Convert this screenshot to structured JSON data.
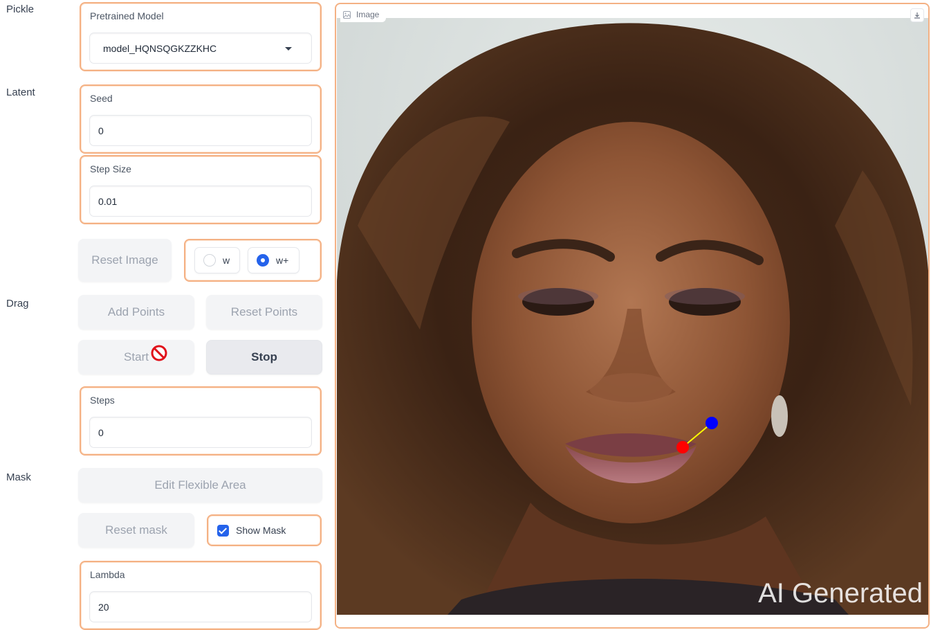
{
  "sections": {
    "pickle": "Pickle",
    "latent": "Latent",
    "drag": "Drag",
    "mask": "Mask"
  },
  "pretrained_model": {
    "label": "Pretrained Model",
    "value": "model_HQNSQGKZZKHC"
  },
  "seed": {
    "label": "Seed",
    "value": "0"
  },
  "step_size": {
    "label": "Step Size",
    "value": "0.01"
  },
  "reset_image_label": "Reset Image",
  "latent_space": {
    "options": [
      "w",
      "w+"
    ],
    "selected": "w+"
  },
  "add_points_label": "Add Points",
  "reset_points_label": "Reset Points",
  "start_label": "Start",
  "stop_label": "Stop",
  "steps": {
    "label": "Steps",
    "value": "0"
  },
  "edit_flexible_area_label": "Edit Flexible Area",
  "reset_mask_label": "Reset mask",
  "show_mask": {
    "label": "Show Mask",
    "checked": true
  },
  "lambda": {
    "label": "Lambda",
    "value": "20"
  },
  "image_panel": {
    "label": "Image",
    "watermark": "AI Generated",
    "handle_point_color": "#ff0000",
    "target_point_color": "#0000ff",
    "drag_line_color": "#ffff00"
  },
  "colors": {
    "accent_border": "#f4b184",
    "primary": "#2563eb"
  }
}
